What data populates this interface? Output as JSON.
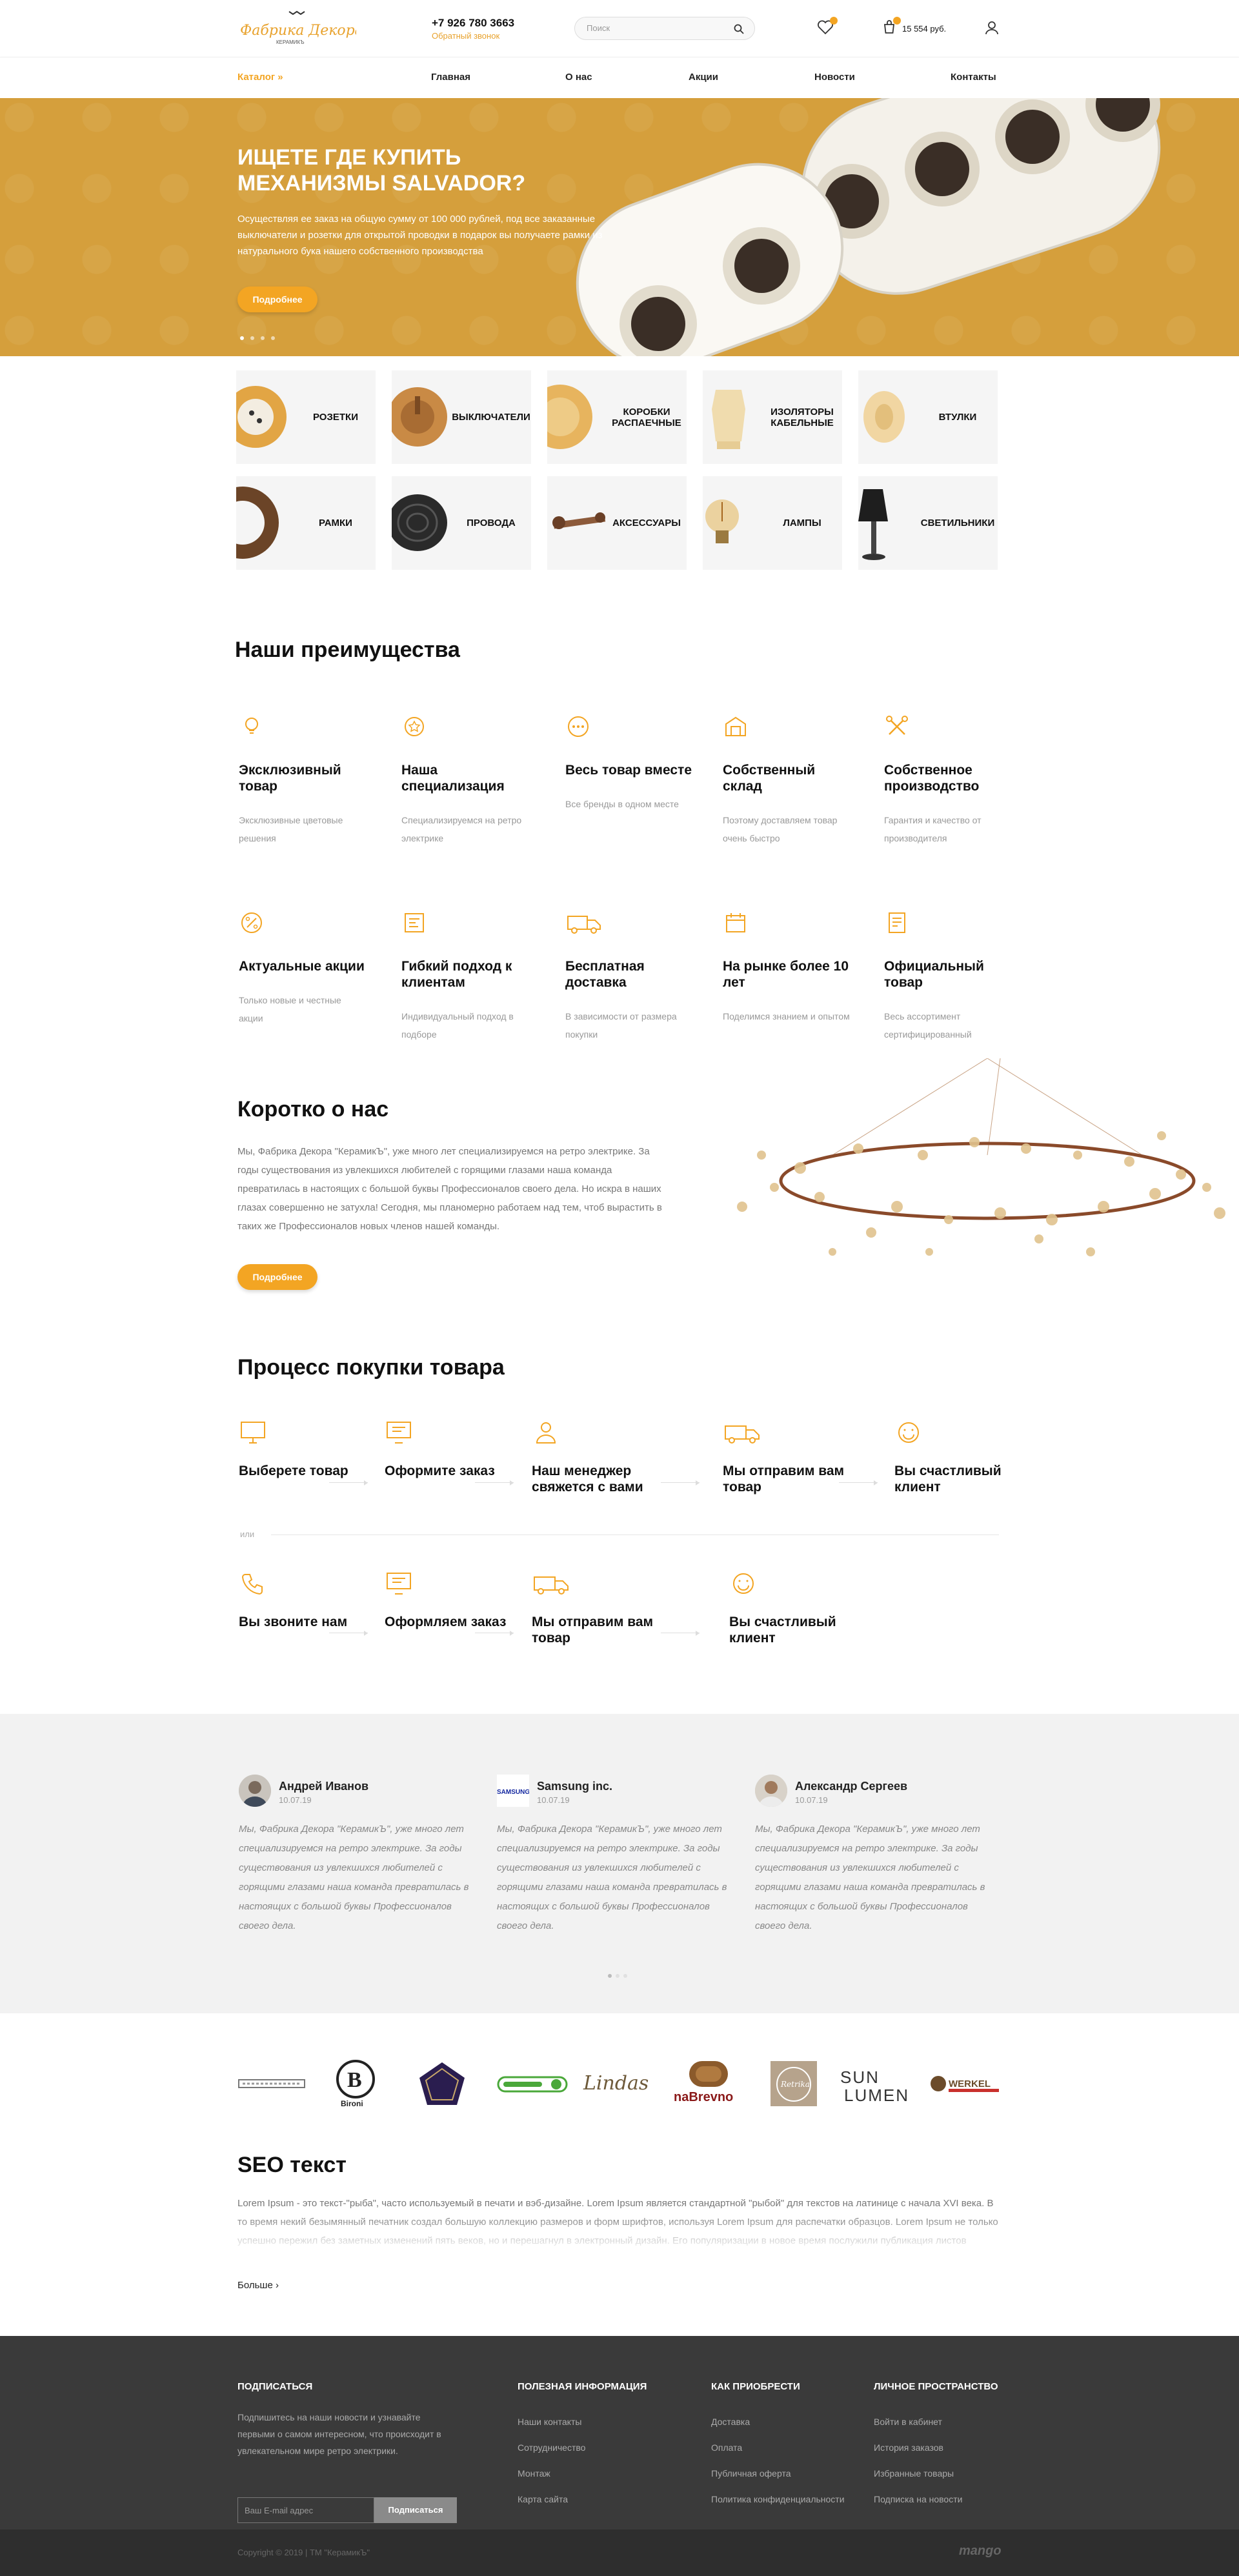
{
  "header": {
    "logo_text": "Фабрика Декора",
    "logo_sub": "КЕРАМИКЪ",
    "phone": "+7 926 780 3663",
    "callback": "Обратный звонок",
    "search_placeholder": "Поиск",
    "cart_sum": "15 554 руб."
  },
  "nav": {
    "catalog": "Каталог",
    "items": [
      "Главная",
      "О нас",
      "Акции",
      "Новости",
      "Контакты"
    ]
  },
  "hero": {
    "title": "Ищете где купить механизмы Salvador?",
    "text": "Осуществляя ее заказ на общую сумму от 100 000 рублей, под все заказанные выключатели и розетки для открытой проводки в подарок вы получаете рамки из натурального бука нашего собственного производства",
    "button": "Подробнее"
  },
  "categories": [
    "Розетки",
    "Выключатели",
    "Коробки распаечные",
    "Изоляторы кабельные",
    "Втулки",
    "Рамки",
    "Провода",
    "Аксессуары",
    "Лампы",
    "Светильники"
  ],
  "advantages": {
    "title": "Наши преимущества",
    "items": [
      {
        "icon": "lightbulb-icon",
        "title": "Эксклюзивный товар",
        "desc": "Эксклюзивные цветовые решения"
      },
      {
        "icon": "award-icon",
        "title": "Наша специализация",
        "desc": "Специализируемся на ретро электрике"
      },
      {
        "icon": "dots-icon",
        "title": "Весь товар вместе",
        "desc": "Все бренды в одном месте"
      },
      {
        "icon": "warehouse-icon",
        "title": "Собственный склад",
        "desc": "Поэтому доставляем товар очень быстро"
      },
      {
        "icon": "tools-icon",
        "title": "Собственное производство",
        "desc": "Гарантия и качество от производителя"
      },
      {
        "icon": "percent-icon",
        "title": "Актуальные акции",
        "desc": "Только новые и честные акции"
      },
      {
        "icon": "flexible-icon",
        "title": "Гибкий подход к клиентам",
        "desc": "Индивидуальный подход в подборе"
      },
      {
        "icon": "truck-icon",
        "title": "Бесплатная доставка",
        "desc": "В зависимости от размера покупки"
      },
      {
        "icon": "calendar-icon",
        "title": "На рынке более 10 лет",
        "desc": "Поделимся знанием и опытом"
      },
      {
        "icon": "certificate-icon",
        "title": "Официальный товар",
        "desc": "Весь ассортимент сертифицированный"
      }
    ]
  },
  "about": {
    "title": "Коротко о нас",
    "text": "Мы, Фабрика Декора \"КерамикЪ\", уже много лет специализируемся на ретро электрике. За годы существования из увлекшихся любителей с горящими глазами наша команда превратилась в настоящих с большой буквы Профессионалов своего дела. Но искра в наших глазах совершенно не затухла! Сегодня, мы планомерно работаем над тем, чтоб вырастить в таких же Профессионалов новых членов нашей команды.",
    "button": "Подробнее"
  },
  "process": {
    "title": "Процесс покупки товара",
    "or": "или",
    "row1": [
      "Выберете товар",
      "Оформите заказ",
      "Наш менеджер свяжется с вами",
      "Мы отправим вам товар",
      "Вы счастливый клиент"
    ],
    "row2": [
      "Вы звоните нам",
      "Оформляем заказ",
      "Мы отправим вам товар",
      "Вы счастливый клиент"
    ]
  },
  "reviews": [
    {
      "name": "Андрей Иванов",
      "date": "10.07.19",
      "text": "Мы, Фабрика Декора \"КерамикЪ\", уже много лет специализируемся на ретро электрике. За годы существования из увлекшихся любителей с горящими глазами наша команда превратилась в настоящих с большой буквы Профессионалов своего дела."
    },
    {
      "name": "Samsung inc.",
      "date": "10.07.19",
      "logo": "SAMSUNG",
      "text": "Мы, Фабрика Декора \"КерамикЪ\", уже много лет специализируемся на ретро электрике. За годы существования из увлекшихся любителей с горящими глазами наша команда превратилась в настоящих с большой буквы Профессионалов своего дела."
    },
    {
      "name": "Александр Сергеев",
      "date": "10.07.19",
      "text": "Мы, Фабрика Декора \"КерамикЪ\", уже много лет специализируемся на ретро электрике. За годы существования из увлекшихся любителей с горящими глазами наша команда превратилась в настоящих с большой буквы Профессионалов своего дела."
    }
  ],
  "brands": [
    "Bironi",
    "Lindas",
    "naBrevno",
    "Retrika",
    "SUN LUMEN",
    "WERKEL"
  ],
  "seo": {
    "title": "SEO текст",
    "text": "Lorem Ipsum - это текст-\"рыба\", часто используемый в печати и вэб-дизайне. Lorem Ipsum является стандартной \"рыбой\" для текстов на латинице с начала XVI века. В то время некий безымянный печатник создал большую коллекцию размеров и форм шрифтов, используя Lorem Ipsum для распечатки образцов. Lorem Ipsum не только успешно пережил без заметных изменений пять веков, но и перешагнул в электронный дизайн. Его популяризации в новое время послужили публикация листов Letraset с образцами Lorem Ipsum в 60-х годах и, в более недавнее время, программы электронной вёрстки.",
    "more": "Больше"
  },
  "footer": {
    "subscribe_title": "Подписаться",
    "subscribe_text": "Подпишитесь на наши новости и узнавайте первыми о самом интересном, что происходит в увлекательном мире ретро электрики.",
    "email_placeholder": "Ваш E-mail адрес",
    "subscribe_button": "Подписаться",
    "cols": [
      {
        "title": "Полезная информация",
        "links": [
          "Наши контакты",
          "Сотрудничество",
          "Монтаж",
          "Карта сайта"
        ]
      },
      {
        "title": "Как приобрести",
        "links": [
          "Доставка",
          "Оплата",
          "Публичная оферта",
          "Политика конфиденциальности"
        ]
      },
      {
        "title": "Личное пространство",
        "links": [
          "Войти в кабинет",
          "История заказов",
          "Избранные товары",
          "Подписка на новости"
        ]
      }
    ],
    "copyright": "Copyright © 2019 | ТМ \"КерамикЪ\"",
    "dev": "mango"
  },
  "colors": {
    "accent": "#f3a523",
    "hero_bg": "#d59f3c",
    "footer": "#3a3a3a"
  }
}
